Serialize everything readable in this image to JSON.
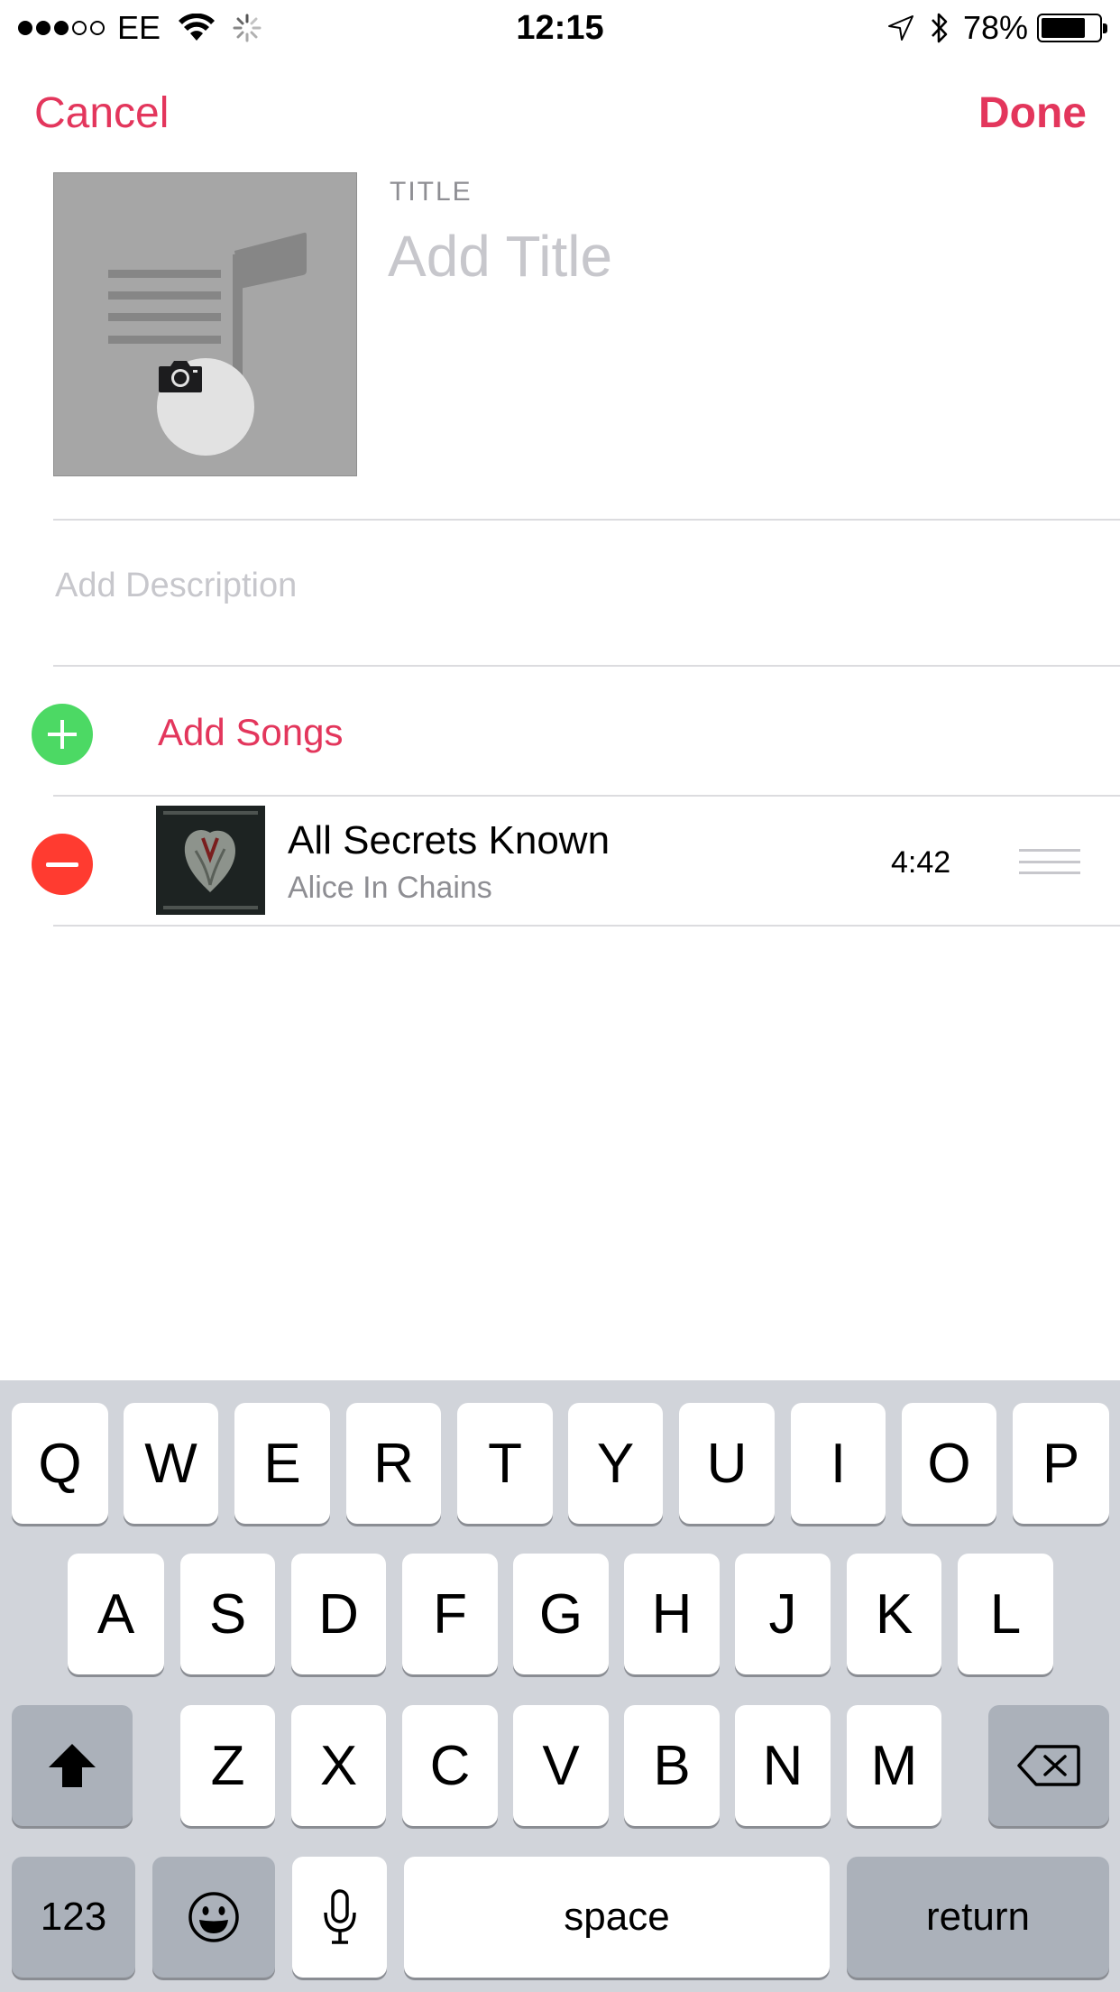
{
  "status_bar": {
    "carrier": "EE",
    "time": "12:15",
    "battery_percent": "78%",
    "battery_level": 0.78,
    "signal_bars_filled": 3,
    "signal_bars_total": 5
  },
  "nav": {
    "cancel_label": "Cancel",
    "done_label": "Done"
  },
  "form": {
    "title_label": "TITLE",
    "title_placeholder": "Add Title",
    "description_placeholder": "Add Description"
  },
  "add_songs_label": "Add Songs",
  "songs": [
    {
      "title": "All Secrets Known",
      "artist": "Alice In Chains",
      "duration": "4:42"
    }
  ],
  "keyboard": {
    "row1": [
      "Q",
      "W",
      "E",
      "R",
      "T",
      "Y",
      "U",
      "I",
      "O",
      "P"
    ],
    "row2": [
      "A",
      "S",
      "D",
      "F",
      "G",
      "H",
      "J",
      "K",
      "L"
    ],
    "row3": [
      "Z",
      "X",
      "C",
      "V",
      "B",
      "N",
      "M"
    ],
    "numbers_label": "123",
    "space_label": "space",
    "return_label": "return"
  },
  "colors": {
    "accent": "#e3365c",
    "add_green": "#4cd964",
    "remove_red": "#ff3b30",
    "keyboard_bg": "#d1d4da"
  },
  "icons": {
    "artwork_placeholder": "music-note-list-icon",
    "camera": "camera-icon",
    "add": "plus-icon",
    "remove": "minus-icon",
    "drag": "drag-handle-icon",
    "shift": "shift-icon",
    "delete": "backspace-icon",
    "emoji": "emoji-icon",
    "dictation": "microphone-icon"
  }
}
